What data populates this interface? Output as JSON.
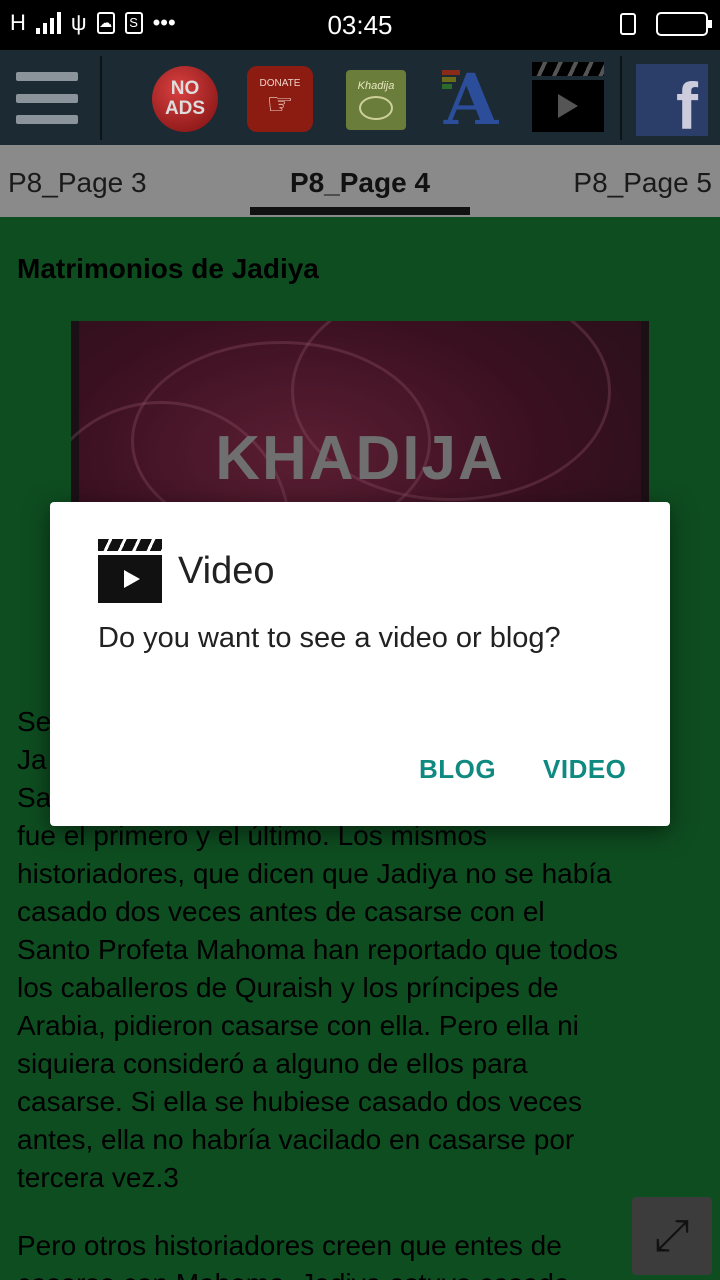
{
  "status_bar": {
    "network": "H",
    "time": "03:45",
    "more": "•••"
  },
  "toolbar": {
    "no_ads_line1": "NO",
    "no_ads_line2": "ADS",
    "donate_label": "DONATE",
    "khadija_label": "Khadija",
    "fb_letter": "f",
    "a_letter": "A"
  },
  "tabs": {
    "prev": "P8_Page 3",
    "active": "P8_Page 4",
    "next": "P8_Page 5"
  },
  "article": {
    "title": "Matrimonios de Jadiya",
    "image_logo": "KHADIJA",
    "paragraph1_lines": [
      "Se",
      "Ja",
      "Sa",
      "fue el primero y el último. Los mismos",
      "historiadores, que dicen que Jadiya no se había",
      "casado dos veces antes de casarse con el",
      "Santo Profeta Mahoma han reportado que todos",
      "los caballeros de Quraish y los príncipes de",
      "Arabia, pidieron casarse con ella. Pero ella ni",
      "siquiera consideró a alguno de ellos para",
      "casarse. Si ella se hubiese casado dos veces",
      "antes, ella no habría vacilado en casarse por",
      "tercera vez.3"
    ],
    "paragraph2_lines": [
      "Pero otros historiadores creen que entes de",
      "casarse con Mahoma, Jadiya estuvo casada"
    ]
  },
  "dialog": {
    "title": "Video",
    "message": "Do you want to see a video or blog?",
    "blog_button": "BLOG",
    "video_button": "VIDEO",
    "icon": "clapperboard-icon"
  },
  "colors": {
    "accent": "#0e8a80",
    "content_bg": "#0e4d20",
    "tabs_bg": "#8a8a8a",
    "toolbar_bg": "#1c2a34"
  }
}
